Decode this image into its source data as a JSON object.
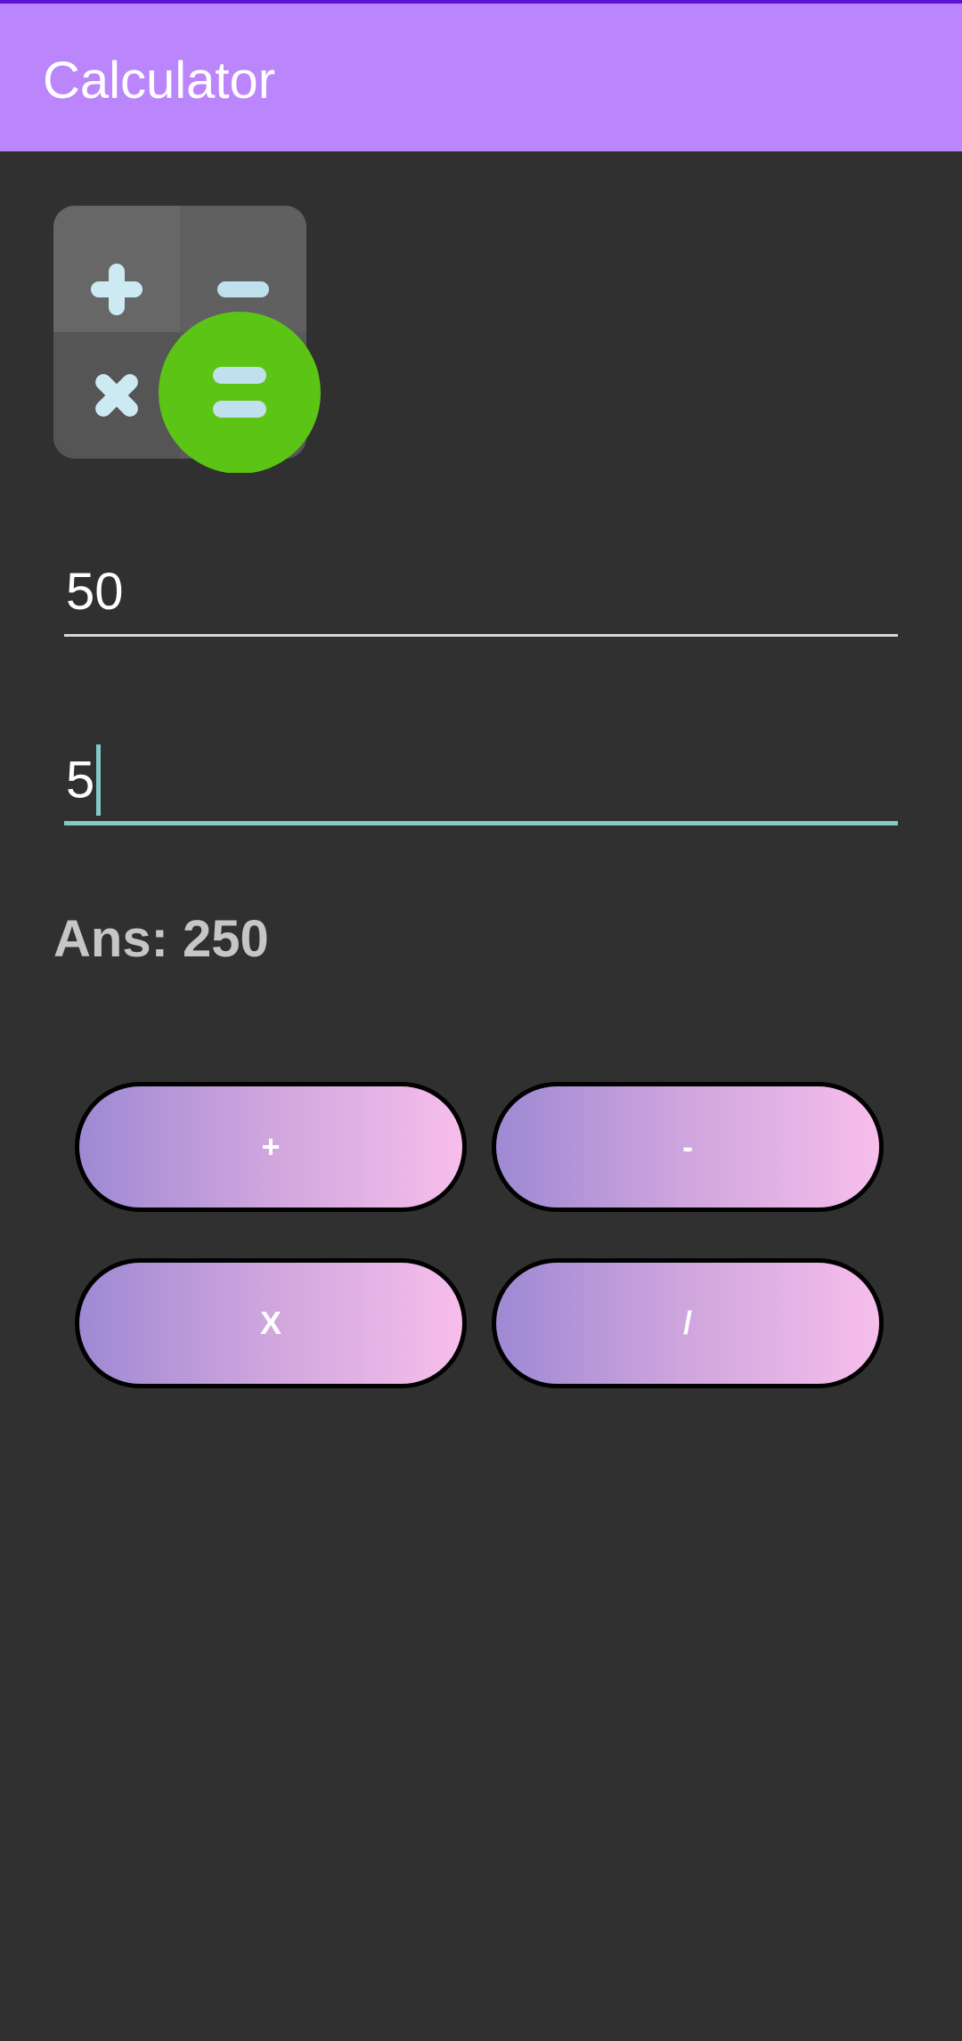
{
  "app_bar": {
    "title": "Calculator",
    "accent": "#BB86FC",
    "status_strip": "#5B13D6"
  },
  "logo": {
    "icons": [
      "plus-icon",
      "minus-icon",
      "multiply-icon",
      "equals-icon"
    ],
    "equals_circle_color": "#5CC414",
    "symbol_color": "#CDEAF3"
  },
  "inputs": {
    "first_value": "50",
    "second_value": "5",
    "focus_color": "#80CBC4"
  },
  "result": {
    "text": "Ans: 250"
  },
  "buttons": {
    "add_label": "+",
    "subtract_label": "-",
    "multiply_label": "X",
    "divide_label": "/"
  }
}
